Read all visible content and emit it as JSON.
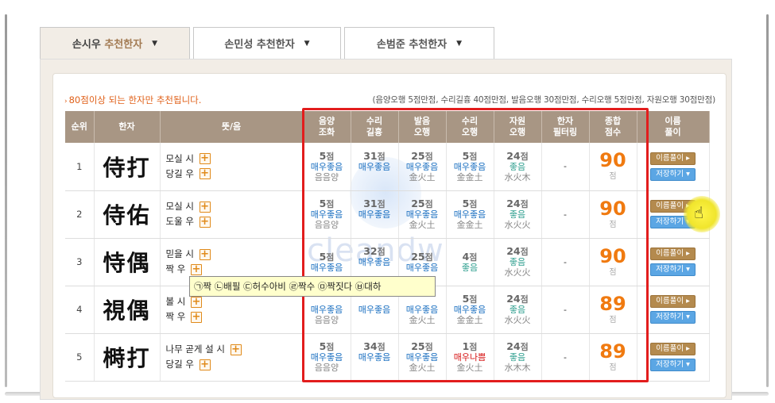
{
  "tabs": [
    {
      "name_main": "손시우",
      "name_sub": "추천한자",
      "caret": "▼"
    },
    {
      "name_main": "손민성",
      "name_sub": "추천한자",
      "caret": "▼"
    },
    {
      "name_main": "손범준",
      "name_sub": "추천한자",
      "caret": "▼"
    }
  ],
  "notice": "80점이상 되는 한자만 추천됩니다.",
  "scoring_note": "(음양오행 5점만점, 수리길흉 40점만점, 발음오행 30점만점, 수리오행 5점만점, 자원오행 30점만점)",
  "headers": {
    "rank": "순위",
    "hanja": "한자",
    "meaning": "뜻/음",
    "yinyang_1": "음양",
    "yinyang_2": "조화",
    "suri_1": "수리",
    "suri_2": "길흉",
    "balum_1": "발음",
    "balum_2": "오행",
    "suri5_1": "수리",
    "suri5_2": "오행",
    "jawon_1": "자원",
    "jawon_2": "오행",
    "filter_1": "한자",
    "filter_2": "필터링",
    "total_1": "종합",
    "total_2": "점수",
    "name_1": "이름",
    "name_2": "풀이"
  },
  "score_unit": "점",
  "buttons": {
    "interpret": "이름풀이 ▸",
    "save": "저장하기 ▾"
  },
  "plus_symbol": "+",
  "rows": [
    {
      "rank": "1",
      "hanja": "侍打",
      "m1": "모실 시",
      "m2": "당길 우",
      "yy": "5",
      "yy_grade": "매우좋음",
      "yy_sub": "음음양",
      "sl": "31",
      "sl_grade": "매우좋음",
      "bo": "25",
      "bo_grade": "매우좋음",
      "bo_sub": "金火土",
      "so": "5",
      "so_grade": "매우좋음",
      "so_sub": "金金土",
      "jw": "24",
      "jw_grade": "좋음",
      "jw_sub": "水火木",
      "filter": "-",
      "total": "90"
    },
    {
      "rank": "2",
      "hanja": "侍佑",
      "m1": "모실 시",
      "m2": "도울 우",
      "yy": "5",
      "yy_grade": "매우좋음",
      "yy_sub": "음음양",
      "sl": "31",
      "sl_grade": "매우좋음",
      "bo": "25",
      "bo_grade": "매우좋음",
      "bo_sub": "金火土",
      "so": "5",
      "so_grade": "매우좋음",
      "so_sub": "金金土",
      "jw": "24",
      "jw_grade": "좋음",
      "jw_sub": "水火火",
      "filter": "-",
      "total": "90"
    },
    {
      "rank": "3",
      "hanja": "恃偶",
      "m1": "믿을 시",
      "m2": "짝 우",
      "yy": "5",
      "yy_grade": "매우좋음",
      "yy_sub": "",
      "sl": "32",
      "sl_grade": "매우좋음",
      "bo": "25",
      "bo_grade": "매우좋음",
      "bo_sub": "",
      "so": "4",
      "so_grade": "좋음",
      "so_sub": "",
      "jw": "24",
      "jw_grade": "좋음",
      "jw_sub": "水火火",
      "filter": "-",
      "total": "90"
    },
    {
      "rank": "4",
      "hanja": "視偶",
      "m1": "볼 시",
      "m2": "짝 우",
      "yy": "",
      "yy_grade": "매우좋음",
      "yy_sub": "음음양",
      "sl": "",
      "sl_grade": "매우좋음",
      "bo": "",
      "bo_grade": "매우좋음",
      "bo_sub": "金火土",
      "so": "5",
      "so_grade": "매우좋음",
      "so_sub": "金金土",
      "jw": "24",
      "jw_grade": "좋음",
      "jw_sub": "水火火",
      "filter": "-",
      "total": "89"
    },
    {
      "rank": "5",
      "hanja": "榯打",
      "m1": "나무 곧게 설 시",
      "m2": "당길 우",
      "yy": "5",
      "yy_grade": "매우좋음",
      "yy_sub": "음음양",
      "sl": "34",
      "sl_grade": "매우좋음",
      "bo": "25",
      "bo_grade": "매우좋음",
      "bo_sub": "金火土",
      "so": "1",
      "so_grade": "매우나쁨",
      "so_sub": "金火土",
      "jw": "24",
      "jw_grade": "좋음",
      "jw_sub": "水木木",
      "filter": "-",
      "total": "89"
    }
  ],
  "tooltip": "㉠짝 ㉡배필 ㉢허수아비 ㉣짝수 ㉤짝짓다 ㉥대하",
  "watermark": "cleandw",
  "colors": {
    "accent": "#f07a10",
    "header_bg": "#a89684",
    "highlight": "#e21d1d",
    "good": "#1a6fc0",
    "ok": "#2f9f8f",
    "bad": "#d61414"
  }
}
